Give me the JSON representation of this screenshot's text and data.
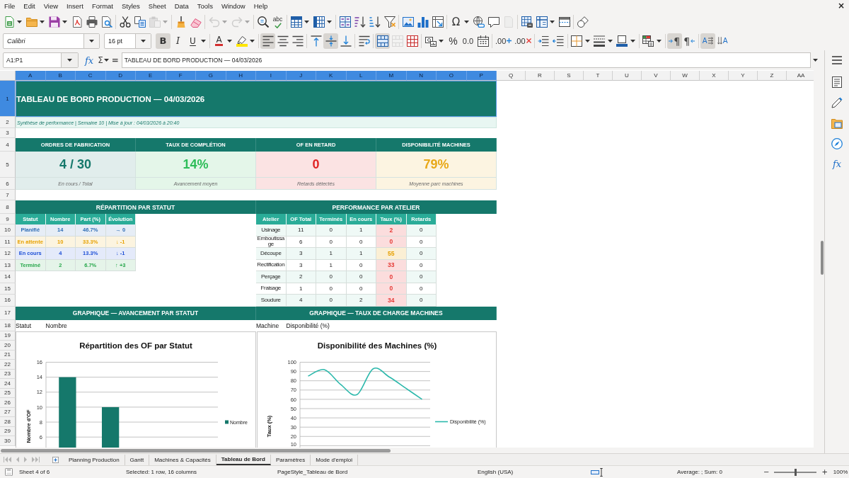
{
  "menu": [
    "File",
    "Edit",
    "View",
    "Insert",
    "Format",
    "Styles",
    "Sheet",
    "Data",
    "Tools",
    "Window",
    "Help"
  ],
  "close_document": "×",
  "standard_toolbar": [
    {
      "disabled": false
    },
    {
      "disabled": false
    },
    {
      "disabled": false
    },
    {
      "disabled": false
    },
    {
      "disabled": false
    },
    {
      "disabled": false
    },
    {
      "disabled": false
    },
    {
      "disabled": false
    },
    {
      "disabled": true
    },
    {
      "disabled": false
    },
    {
      "disabled": false
    },
    {
      "disabled": true
    },
    {
      "disabled": true
    },
    {
      "disabled": false
    },
    {
      "label": "abc",
      "disabled": false
    },
    {
      "disabled": false
    },
    {
      "disabled": false
    },
    {
      "disabled": false
    },
    {
      "disabled": false
    },
    {
      "disabled": false
    },
    {
      "disabled": false
    },
    {
      "disabled": false
    },
    {
      "disabled": false
    },
    {
      "disabled": false
    },
    {
      "label": "Ω",
      "disabled": false
    },
    {
      "disabled": false
    },
    {
      "disabled": false
    },
    {
      "disabled": true
    },
    {
      "disabled": false
    },
    {
      "disabled": false
    },
    {
      "disabled": false
    },
    {
      "disabled": false
    }
  ],
  "formatting_toolbar": {
    "font_name": "Calibri",
    "font_size": "16 pt",
    "buttons": [
      {
        "label": "B",
        "pressed": true,
        "disabled": false
      },
      {
        "label": "I",
        "pressed": false,
        "disabled": false
      },
      {
        "label": "U",
        "pressed": false,
        "disabled": false
      },
      {
        "label": "A",
        "pressed": false,
        "disabled": false
      },
      {
        "pressed": false,
        "disabled": false
      },
      {
        "pressed": true,
        "disabled": false
      },
      {
        "pressed": false,
        "disabled": false
      },
      {
        "pressed": false,
        "disabled": false
      },
      {
        "pressed": false,
        "disabled": false
      },
      {
        "pressed": true,
        "disabled": false
      },
      {
        "pressed": false,
        "disabled": false
      },
      {
        "pressed": false,
        "disabled": false
      },
      {
        "pressed": true,
        "disabled": false
      },
      {
        "pressed": false,
        "disabled": true
      },
      {
        "pressed": false,
        "disabled": false
      },
      {
        "pressed": false,
        "disabled": false
      },
      {
        "label": "%",
        "pressed": false,
        "disabled": false
      },
      {
        "label": "0.0",
        "pressed": false,
        "disabled": false
      },
      {
        "pressed": false,
        "disabled": false
      },
      {
        "label": ".00",
        "pressed": false,
        "disabled": false
      },
      {
        "label": ".00",
        "pressed": false,
        "disabled": false
      },
      {
        "pressed": false,
        "disabled": false
      },
      {
        "pressed": false,
        "disabled": false
      },
      {
        "pressed": false,
        "disabled": false
      },
      {
        "pressed": false,
        "disabled": false
      },
      {
        "pressed": false,
        "disabled": false
      },
      {
        "pressed": false,
        "disabled": false
      },
      {
        "label": "¶",
        "pressed": true,
        "disabled": false
      },
      {
        "label": "¶",
        "pressed": false,
        "disabled": false
      },
      {
        "label": "A",
        "pressed": true,
        "disabled": false
      },
      {
        "label": "A",
        "pressed": false,
        "disabled": false
      }
    ]
  },
  "formula_bar": {
    "name_box": "A1:P1",
    "function_wizard": "fx",
    "sum": "Σ",
    "equals": "=",
    "content": "TABLEAU DE BORD PRODUCTION — 04/03/2026"
  },
  "sidebar": {
    "functions": "fx"
  },
  "sheet": {
    "columns": [
      {
        "label": "A",
        "selected": true
      },
      {
        "label": "B",
        "selected": true
      },
      {
        "label": "C",
        "selected": true
      },
      {
        "label": "D",
        "selected": true
      },
      {
        "label": "E",
        "selected": true
      },
      {
        "label": "F",
        "selected": true
      },
      {
        "label": "G",
        "selected": true
      },
      {
        "label": "H",
        "selected": true
      },
      {
        "label": "I",
        "selected": true
      },
      {
        "label": "J",
        "selected": true
      },
      {
        "label": "K",
        "selected": true
      },
      {
        "label": "L",
        "selected": true
      },
      {
        "label": "M",
        "selected": true
      },
      {
        "label": "N",
        "selected": true
      },
      {
        "label": "O",
        "selected": true
      },
      {
        "label": "P",
        "selected": true
      },
      {
        "label": "Q",
        "selected": false
      },
      {
        "label": "R",
        "selected": false
      },
      {
        "label": "S",
        "selected": false
      },
      {
        "label": "T",
        "selected": false
      },
      {
        "label": "U",
        "selected": false
      },
      {
        "label": "V",
        "selected": false
      },
      {
        "label": "W",
        "selected": false
      },
      {
        "label": "X",
        "selected": false
      },
      {
        "label": "Y",
        "selected": false
      },
      {
        "label": "Z",
        "selected": false
      },
      {
        "label": "AA",
        "selected": false
      }
    ],
    "rows": [
      {
        "label": "1",
        "selected": true
      },
      {
        "label": "2",
        "selected": false
      },
      {
        "label": "3",
        "selected": false
      },
      {
        "label": "4",
        "selected": false
      },
      {
        "label": "5",
        "selected": false
      },
      {
        "label": "6",
        "selected": false
      },
      {
        "label": "7",
        "selected": false
      },
      {
        "label": "8",
        "selected": false
      },
      {
        "label": "9",
        "selected": false
      },
      {
        "label": "10",
        "selected": false
      },
      {
        "label": "11",
        "selected": false
      },
      {
        "label": "12",
        "selected": false
      },
      {
        "label": "13",
        "selected": false
      },
      {
        "label": "14",
        "selected": false
      },
      {
        "label": "15",
        "selected": false
      },
      {
        "label": "16",
        "selected": false
      },
      {
        "label": "17",
        "selected": false
      },
      {
        "label": "18",
        "selected": false
      },
      {
        "label": "19",
        "selected": false
      },
      {
        "label": "20",
        "selected": false
      },
      {
        "label": "21",
        "selected": false
      },
      {
        "label": "22",
        "selected": false
      },
      {
        "label": "23",
        "selected": false
      },
      {
        "label": "24",
        "selected": false
      },
      {
        "label": "25",
        "selected": false
      },
      {
        "label": "26",
        "selected": false
      },
      {
        "label": "27",
        "selected": false
      },
      {
        "label": "28",
        "selected": false
      },
      {
        "label": "29",
        "selected": false
      },
      {
        "label": "30",
        "selected": false
      }
    ],
    "title": {
      "text": "TABLEAU DE BORD PRODUCTION — 04/03/2026",
      "selected": true
    },
    "subtitle": "Synthèse de performance | Semaine 10 | Mise à jour : 04/03/2026 à 20:40",
    "kpis": [
      {
        "heading": "ORDRES DE FABRICATION",
        "value": "4 / 30",
        "note": "En cours / Total",
        "color": "#15786b"
      },
      {
        "heading": "TAUX DE COMPLÉTION",
        "value": "14%",
        "note": "Avancement moyen",
        "color": "#2ebd59"
      },
      {
        "heading": "OF EN RETARD",
        "value": "0",
        "note": "Retards détectés",
        "color": "#e02424"
      },
      {
        "heading": "DISPONIBILITÉ MACHINES",
        "value": "79%",
        "note": "Moyenne parc machines",
        "color": "#e8a818"
      }
    ],
    "status_table": {
      "heading": "RÉPARTITION PAR STATUT",
      "columns": [
        "Statut",
        "Nombre",
        "Part (%)",
        "Évolution"
      ],
      "rows": [
        {
          "statut": "Planifié",
          "nombre": "14",
          "part": "46.7%",
          "evolution": "→ 0",
          "color": "#2f6db5"
        },
        {
          "statut": "En attente",
          "nombre": "10",
          "part": "33.3%",
          "evolution": "↓ -1",
          "color": "#e6a000"
        },
        {
          "statut": "En cours",
          "nombre": "4",
          "part": "13.3%",
          "evolution": "↓ -1",
          "color": "#1d4fd6"
        },
        {
          "statut": "Terminé",
          "nombre": "2",
          "part": "6.7%",
          "evolution": "↑ +3",
          "color": "#26a74a"
        }
      ]
    },
    "workshop_table": {
      "heading": "PERFORMANCE PAR ATELIER",
      "columns": [
        "Atelier",
        "OF Total",
        "Terminés",
        "En cours",
        "Taux (%)",
        "Retards"
      ],
      "rows": [
        {
          "atelier": "Usinage",
          "of_total": "11",
          "termines": "0",
          "en_cours": "1",
          "taux": "2",
          "retards": "0",
          "color": "#e53935"
        },
        {
          "atelier": "Emboutissage",
          "of_total": "6",
          "termines": "0",
          "en_cours": "0",
          "taux": "0",
          "retards": "0",
          "color": "#e53935"
        },
        {
          "atelier": "Découpe",
          "of_total": "3",
          "termines": "1",
          "en_cours": "1",
          "taux": "55",
          "retards": "0",
          "color": "#e6a000"
        },
        {
          "atelier": "Rectification",
          "of_total": "3",
          "termines": "1",
          "en_cours": "0",
          "taux": "33",
          "retards": "0",
          "color": "#e53935"
        },
        {
          "atelier": "Perçage",
          "of_total": "2",
          "termines": "0",
          "en_cours": "0",
          "taux": "0",
          "retards": "0",
          "color": "#e53935"
        },
        {
          "atelier": "Fraisage",
          "of_total": "1",
          "termines": "0",
          "en_cours": "0",
          "taux": "0",
          "retards": "0",
          "color": "#e53935"
        },
        {
          "atelier": "Soudure",
          "of_total": "4",
          "termines": "0",
          "en_cours": "2",
          "taux": "34",
          "retards": "0",
          "color": "#e53935"
        }
      ]
    },
    "charts": [
      {
        "heading": "GRAPHIQUE — AVANCEMENT PAR STATUT",
        "labels": [
          "Statut",
          "Nombre"
        ],
        "chart_data": {
          "type": "bar",
          "title": "Répartition des OF par Statut",
          "ylabel": "Nombre d'OF",
          "series": [
            {
              "name": "Nombre",
              "color": "#15786b",
              "values": [
                14,
                10,
                null,
                null
              ]
            }
          ],
          "ylim": [
            4.6,
            16
          ],
          "yticks": [
            6,
            8,
            10,
            12,
            14,
            16
          ],
          "grid": true
        }
      },
      {
        "heading": "GRAPHIQUE — TAUX DE CHARGE MACHINES",
        "labels": [
          "Machine",
          "Disponibilité (%)"
        ],
        "chart_data": {
          "type": "line",
          "title": "Disponibilité des Machines (%)",
          "ylabel": "Taux (%)",
          "series": [
            {
              "name": "Disponibilité (%)",
              "color": "#2bb8ab",
              "values": [
                85,
                92,
                76,
                65,
                93,
                84,
                72,
                60
              ]
            }
          ],
          "ylim": [
            8,
            100
          ],
          "yticks": [
            10,
            20,
            30,
            40,
            50,
            60,
            70,
            80,
            90,
            100
          ],
          "grid": true
        }
      }
    ]
  },
  "tab_navigation": [
    {
      "disabled": true
    },
    {
      "disabled": true
    },
    {
      "disabled": true
    },
    {
      "disabled": true
    }
  ],
  "sheet_tabs": [
    {
      "label": "Planning Production",
      "selected": false
    },
    {
      "label": "Gantt",
      "selected": false
    },
    {
      "label": "Machines & Capacités",
      "selected": false
    },
    {
      "label": "Tableau de Bord",
      "selected": true
    },
    {
      "label": "Paramètres",
      "selected": false
    },
    {
      "label": "Mode d'emploi",
      "selected": false
    }
  ],
  "status_bar": {
    "sheet": "Sheet 4 of 6",
    "selection": "Selected: 1 row, 16 columns",
    "page_style": "PageStyle_Tableau de Bord",
    "language": "English (USA)",
    "summary": "Average: ; Sum: 0",
    "zoom": {
      "minus": "−",
      "plus": "+",
      "level": 0.5,
      "reading": "100%"
    }
  }
}
